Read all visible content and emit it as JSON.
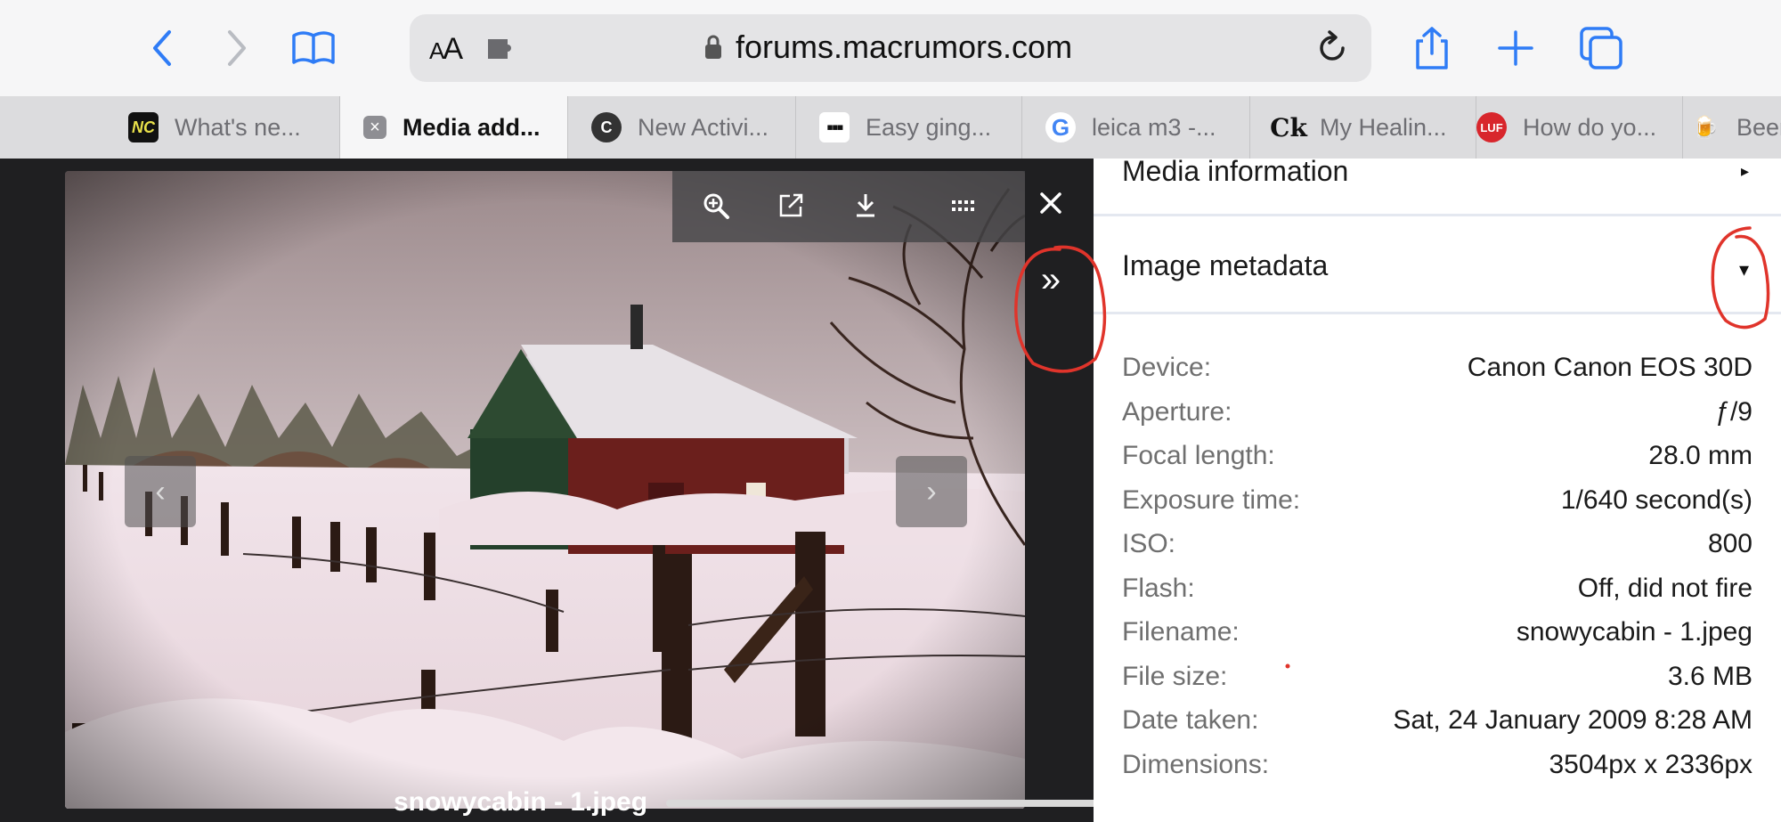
{
  "browser": {
    "url": "forums.macrumors.com",
    "aa_label_big": "A",
    "aa_label_small": "A"
  },
  "tabs": [
    {
      "label": "What's ne...",
      "icon": "nc-logo-icon",
      "active": false
    },
    {
      "label": "Media add...",
      "icon": "close-tab-icon",
      "active": true
    },
    {
      "label": "New Activi...",
      "icon": "c-logo-icon",
      "active": false
    },
    {
      "label": "Easy ging...",
      "icon": "dots-logo-icon",
      "active": false
    },
    {
      "label": "leica m3 -...",
      "icon": "google-icon",
      "active": false
    },
    {
      "label": "My Healin...",
      "icon": "ck-logo-icon",
      "active": false
    },
    {
      "label": "How do yo...",
      "icon": "luf-logo-icon",
      "active": false
    },
    {
      "label": "Beer",
      "icon": "beer-icon",
      "active": false
    }
  ],
  "tab_icon_text": {
    "nc": "NC",
    "c": "C",
    "g": "G",
    "ck": "Ck",
    "luf": "LUF"
  },
  "lightbox": {
    "caption": "snowycabin - 1.jpeg",
    "close_glyph": "×",
    "expand_glyph": "»",
    "prev_glyph": "‹",
    "next_glyph": "›"
  },
  "panel": {
    "media_information": "Media information",
    "image_metadata": "Image metadata",
    "metadata": [
      {
        "label": "Device:",
        "value": "Canon Canon EOS 30D"
      },
      {
        "label": "Aperture:",
        "value": "ƒ/9"
      },
      {
        "label": "Focal length:",
        "value": "28.0 mm"
      },
      {
        "label": "Exposure time:",
        "value": "1/640 second(s)"
      },
      {
        "label": "ISO:",
        "value": "800"
      },
      {
        "label": "Flash:",
        "value": "Off, did not fire"
      },
      {
        "label": "Filename:",
        "value": "snowycabin - 1.jpeg"
      },
      {
        "label": "File size:",
        "value": "3.6 MB"
      },
      {
        "label": "Date taken:",
        "value": "Sat, 24 January 2009 8:28 AM"
      },
      {
        "label": "Dimensions:",
        "value": "3504px x 2336px"
      }
    ]
  },
  "colors": {
    "accent": "#2f7cf6",
    "annotation": "#e0342b"
  }
}
